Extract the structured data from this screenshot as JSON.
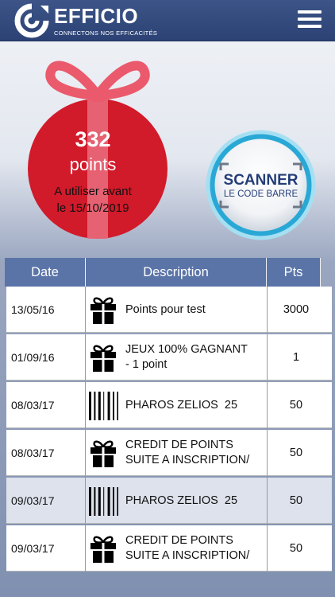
{
  "header": {
    "brand": "EFFICIO",
    "tagline": "CONNECTONS NOS EFFICACITÉS",
    "menu_icon": "hamburger-menu-icon"
  },
  "balance": {
    "points": "332",
    "points_label": "points",
    "use_before_line1": "A utiliser avant",
    "use_before_line2": "le 15/10/2019",
    "gift_color": "#d11a2a"
  },
  "scanner": {
    "title": "SCANNER",
    "subtitle": "LE CODE BARRE",
    "accent": "#29a8d6"
  },
  "table": {
    "headers": [
      "Date",
      "Description",
      "Pts"
    ],
    "rows": [
      {
        "date": "13/05/16",
        "icon": "gift-icon",
        "desc": "Points pour test",
        "pts": "3000"
      },
      {
        "date": "01/09/16",
        "icon": "gift-icon",
        "desc": "JEUX 100% GAGNANT\n- 1 point",
        "pts": "1"
      },
      {
        "date": "08/03/17",
        "icon": "barcode-icon",
        "desc": "PHAROS ZELIOS  25",
        "pts": "50"
      },
      {
        "date": "08/03/17",
        "icon": "gift-icon",
        "desc": "CREDIT DE POINTS\nSUITE A INSCRIPTION/",
        "pts": "50"
      },
      {
        "date": "09/03/17",
        "icon": "barcode-icon",
        "desc": "PHAROS ZELIOS  25",
        "pts": "50"
      },
      {
        "date": "09/03/17",
        "icon": "gift-icon",
        "desc": "CREDIT DE POINTS\nSUITE A INSCRIPTION/",
        "pts": "50"
      }
    ]
  }
}
